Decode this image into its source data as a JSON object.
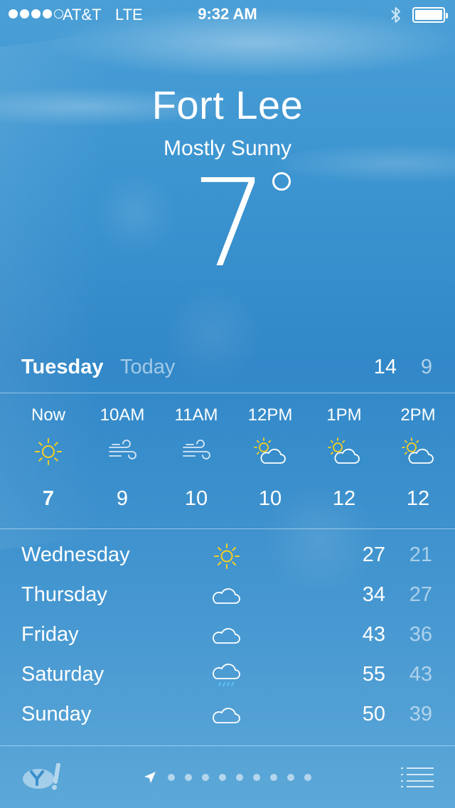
{
  "status_bar": {
    "carrier": "AT&T",
    "network": "LTE",
    "time": "9:32 AM",
    "signal_bars_filled": 4,
    "signal_bars_total": 5,
    "battery_level": 1.0
  },
  "location": {
    "city": "Fort Lee",
    "condition": "Mostly Sunny",
    "temperature": "7"
  },
  "today": {
    "day": "Tuesday",
    "label": "Today",
    "high": "14",
    "low": "9"
  },
  "hourly": [
    {
      "time": "Now",
      "icon": "sun-icon",
      "temp": "7"
    },
    {
      "time": "10AM",
      "icon": "wind-icon",
      "temp": "9"
    },
    {
      "time": "11AM",
      "icon": "wind-icon",
      "temp": "10"
    },
    {
      "time": "12PM",
      "icon": "partly-cloudy-icon",
      "temp": "10"
    },
    {
      "time": "1PM",
      "icon": "partly-cloudy-icon",
      "temp": "12"
    },
    {
      "time": "2PM",
      "icon": "partly-cloudy-icon",
      "temp": "12"
    }
  ],
  "daily": [
    {
      "day": "Wednesday",
      "icon": "sun-icon",
      "high": "27",
      "low": "21"
    },
    {
      "day": "Thursday",
      "icon": "cloud-icon",
      "high": "34",
      "low": "27"
    },
    {
      "day": "Friday",
      "icon": "cloud-icon",
      "high": "43",
      "low": "36"
    },
    {
      "day": "Saturday",
      "icon": "cloud-rain-icon",
      "high": "55",
      "low": "43"
    },
    {
      "day": "Sunday",
      "icon": "cloud-icon",
      "high": "50",
      "low": "39"
    }
  ],
  "bottom_bar": {
    "page_count": 9,
    "current_page": 0
  },
  "colors": {
    "sun": "#f5d020",
    "text": "#ffffff",
    "sky": "#3a8fcc"
  }
}
